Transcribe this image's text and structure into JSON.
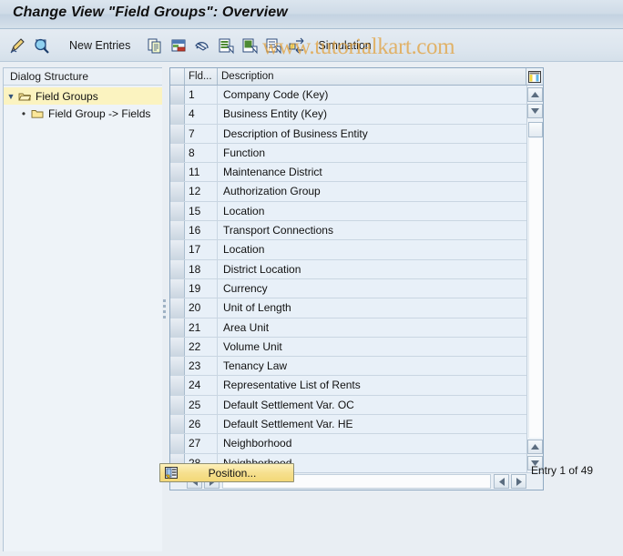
{
  "window": {
    "title": "Change View \"Field Groups\": Overview"
  },
  "watermark": {
    "text": "www.tutorialkart.com",
    "color": "#e2a13c"
  },
  "toolbar": {
    "items": [
      {
        "name": "change-display-icon",
        "icon": "pencil-icon",
        "label": ""
      },
      {
        "name": "display-detail-icon",
        "icon": "magnifier-icon",
        "label": ""
      },
      {
        "name": "new-entries-button",
        "icon": "",
        "label": "New Entries"
      },
      {
        "name": "copy-as-icon",
        "icon": "copy-icon",
        "label": ""
      },
      {
        "name": "delete-icon",
        "icon": "delete-row-icon",
        "label": ""
      },
      {
        "name": "undo-icon",
        "icon": "undo-arrow-icon",
        "label": ""
      },
      {
        "name": "select-all-icon",
        "icon": "select-all-icon",
        "label": ""
      },
      {
        "name": "select-block-icon",
        "icon": "select-block-icon",
        "label": ""
      },
      {
        "name": "deselect-all-icon",
        "icon": "deselect-all-icon",
        "label": ""
      },
      {
        "name": "simulation-button",
        "icon": "transfer-icon",
        "label": "Simulation"
      }
    ]
  },
  "sidebar": {
    "header": "Dialog Structure",
    "items": [
      {
        "label": "Field Groups",
        "icon": "open-folder-icon",
        "selected": true,
        "level": 0,
        "expander": "▼"
      },
      {
        "label": "Field Group -> Fields",
        "icon": "folder-icon",
        "selected": false,
        "level": 1,
        "expander": "•"
      }
    ]
  },
  "table": {
    "columns": [
      {
        "key": "select",
        "label": ""
      },
      {
        "key": "fld",
        "label": "Fld..."
      },
      {
        "key": "description",
        "label": "Description"
      }
    ],
    "header_icon": "table-settings-icon",
    "rows": [
      {
        "fld": "1",
        "description": "Company Code (Key)"
      },
      {
        "fld": "4",
        "description": "Business Entity (Key)"
      },
      {
        "fld": "7",
        "description": "Description of Business Entity"
      },
      {
        "fld": "8",
        "description": "Function"
      },
      {
        "fld": "11",
        "description": "Maintenance District"
      },
      {
        "fld": "12",
        "description": "Authorization Group"
      },
      {
        "fld": "15",
        "description": "Location"
      },
      {
        "fld": "16",
        "description": "Transport Connections"
      },
      {
        "fld": "17",
        "description": "Location"
      },
      {
        "fld": "18",
        "description": "District Location"
      },
      {
        "fld": "19",
        "description": "Currency"
      },
      {
        "fld": "20",
        "description": "Unit of Length"
      },
      {
        "fld": "21",
        "description": "Area Unit"
      },
      {
        "fld": "22",
        "description": "Volume Unit"
      },
      {
        "fld": "23",
        "description": "Tenancy Law"
      },
      {
        "fld": "24",
        "description": "Representative List of Rents"
      },
      {
        "fld": "25",
        "description": "Default Settlement Var. OC"
      },
      {
        "fld": "26",
        "description": "Default Settlement Var. HE"
      },
      {
        "fld": "27",
        "description": "Neighborhood"
      },
      {
        "fld": "28",
        "description": "Neighborhood"
      }
    ]
  },
  "footer": {
    "position_button": "Position...",
    "position_icon": "position-icon",
    "entry_status": "Entry 1 of 49"
  }
}
